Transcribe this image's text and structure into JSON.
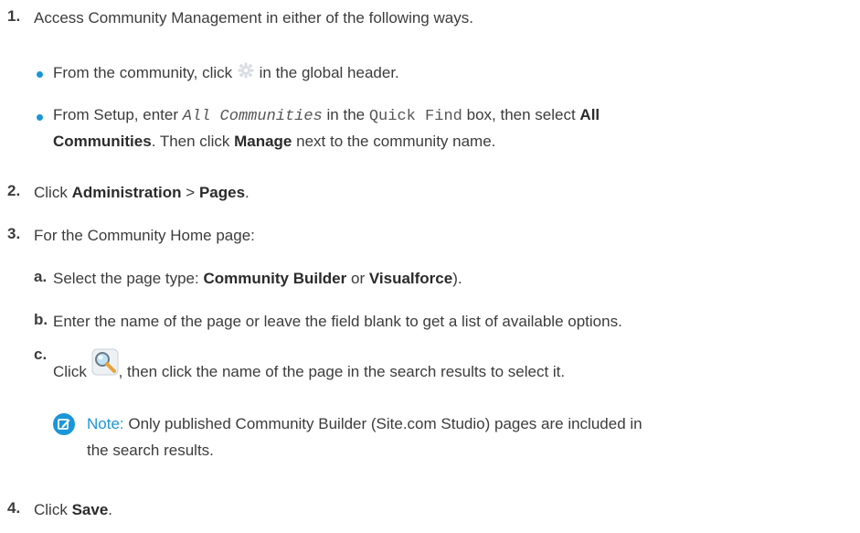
{
  "steps": {
    "s1": {
      "num": "1.",
      "text": "Access Community Management in either of the following ways."
    },
    "b1": {
      "pre": "From the community, click",
      "post": "in the global header.",
      "icon": "gear-icon"
    },
    "b2": {
      "p1": "From Setup, enter",
      "code1": "All Communities",
      "p2": "in the",
      "code2": "Quick Find",
      "p3": "box, then select",
      "bold1a": "All",
      "bold1b": "Communities",
      "p4": ". Then click",
      "bold2": "Manage",
      "p5": "next to the community name."
    },
    "s2": {
      "num": "2.",
      "pre": "Click",
      "bold1": "Administration",
      "sep": ">",
      "bold2": "Pages",
      "post": "."
    },
    "s3": {
      "num": "3.",
      "text": "For the Community Home page:"
    },
    "sa": {
      "num": "a.",
      "pre": "Select the page type:",
      "bold1": "Community Builder",
      "mid": "or",
      "bold2": "Visualforce",
      "post": ")."
    },
    "sb": {
      "num": "b.",
      "text": "Enter the name of the page or leave the field blank to get a list of available options."
    },
    "sc": {
      "num": "c.",
      "pre": "Click",
      "post": ", then click the name of the page in the search results to select it.",
      "icon": "lookup-search-icon"
    },
    "note": {
      "label": "Note:",
      "line1": "Only published Community Builder (Site.com Studio) pages are included in",
      "line2": "the search results.",
      "icon": "note-edit-icon"
    },
    "s4": {
      "num": "4.",
      "pre": "Click",
      "bold": "Save",
      "post": "."
    }
  },
  "colors": {
    "accent": "#1b96d8",
    "text": "#3c3c3c"
  }
}
